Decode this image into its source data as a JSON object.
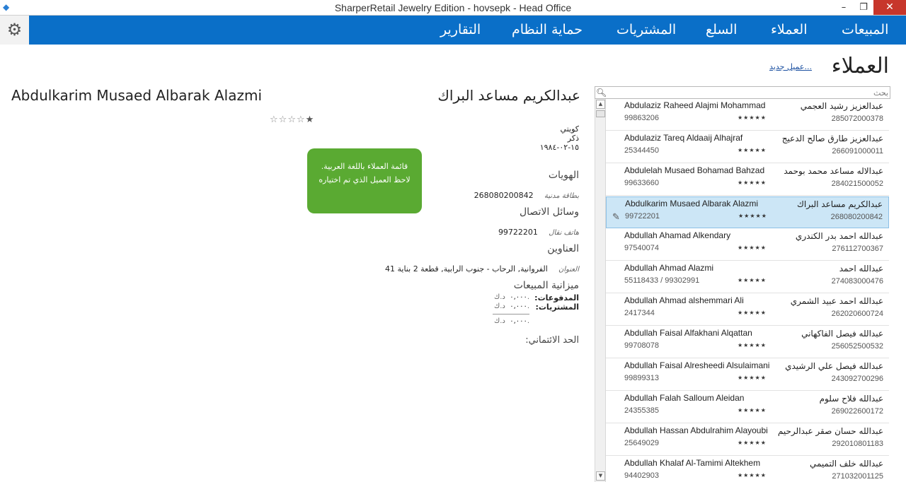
{
  "window": {
    "title": "SharperRetail Jewelry Edition - hovsepk - Head Office",
    "minimize": "–",
    "maximize": "❐",
    "close": "✕"
  },
  "menu": {
    "items": [
      "المبيعات",
      "العملاء",
      "السلع",
      "المشتريات",
      "حماية النظام",
      "التقارير"
    ]
  },
  "page": {
    "title": "العملاء",
    "new_customer": "عميل جديد...",
    "search_placeholder": "بحث"
  },
  "customers": [
    {
      "en": "Abdulaziz Raheed Alajmi Mohammad",
      "ar": "عبدالعزيز رشيد العجمي",
      "phone": "99863206",
      "code": "285072000378",
      "stars": "★★★★★"
    },
    {
      "en": "Abdulaziz Tareq Aldaaij Alhajraf",
      "ar": "عبدالعزيز طارق صالح الدعيج",
      "phone": "25344450",
      "code": "266091000011",
      "stars": "★★★★★"
    },
    {
      "en": "Abdulelah Musaed Bohamad Bahzad",
      "ar": "عبدالاله مساعد محمد بوحمد",
      "phone": "99633660",
      "code": "284021500052",
      "stars": "★★★★★"
    },
    {
      "en": "Abdulkarim Musaed Albarak Alazmi",
      "ar": "عبدالكريم مساعد البراك",
      "phone": "99722201",
      "code": "268080200842",
      "stars": "★★★★★",
      "selected": true
    },
    {
      "en": "Abdullah Ahamad Alkendary",
      "ar": "عبدالله احمد بدر الكندري",
      "phone": "97540074",
      "code": "276112700367",
      "stars": "★★★★★"
    },
    {
      "en": "Abdullah Ahmad Alazmi",
      "ar": "عبدالله احمد",
      "phone": "55118433 / 99302991",
      "code": "274083000476",
      "stars": "★★★★★"
    },
    {
      "en": "Abdullah Ahmad alshemmari Ali",
      "ar": "عبدالله احمد عبيد الشمري",
      "phone": "2417344",
      "code": "262020600724",
      "stars": "★★★★★"
    },
    {
      "en": "Abdullah Faisal Alfakhani Alqattan",
      "ar": "عبدالله فيصل الفاكهاني",
      "phone": "99708078",
      "code": "256052500532",
      "stars": "★★★★★"
    },
    {
      "en": "Abdullah Faisal Alresheedi Alsulaimani",
      "ar": "عبدالله فيصل علي الرشيدي",
      "phone": "99899313",
      "code": "243092700296",
      "stars": "★★★★★"
    },
    {
      "en": "Abdullah Falah Salloum Aleidan",
      "ar": "عبدالله فلاح سلوم",
      "phone": "24355385",
      "code": "269022600172",
      "stars": "★★★★★"
    },
    {
      "en": "Abdullah Hassan Abdulrahim Alayoubi",
      "ar": "عبدالله حسان صقر عبدالرحيم",
      "phone": "25649029",
      "code": "292010801183",
      "stars": "★★★★★"
    },
    {
      "en": "Abdullah Khalaf Al-Tamimi Altekhem",
      "ar": "عبدالله خلف التميمي",
      "phone": "94402903",
      "code": "271032001125",
      "stars": "★★★★★"
    }
  ],
  "detail": {
    "en_name": "Abdulkarim Musaed Albarak Alazmi",
    "ar_name": "عبدالكريم مساعد البراك",
    "rating": 1,
    "nationality": "كويتي",
    "gender": "ذكر",
    "birthdate": "١٥-٠٢-١٩٨٤",
    "ids_head": "الهويات",
    "id_label": "بطاقة مدنية",
    "id_value": "268080200842",
    "contact_head": "وسائل الاتصال",
    "phone_label": "هاتف نقال",
    "phone_value": "99722201",
    "address_head": "العناوين",
    "address_label": "العنوان",
    "address_value": "الفروانية, الرحاب - جنوب الرابية, قطعة 2 بناية 41",
    "budget_head": "ميزانية المبيعات",
    "payments_label": "المدفوعات:",
    "purchases_label": "المشتريات:",
    "currency": "د.ك.",
    "zero": "٠,٠٠٠",
    "credit_label": "الحد الائتماني:"
  },
  "callout": {
    "text": "قائمة العملاء باللغة العربية. لاحظ العميل الذي تم اختياره"
  }
}
